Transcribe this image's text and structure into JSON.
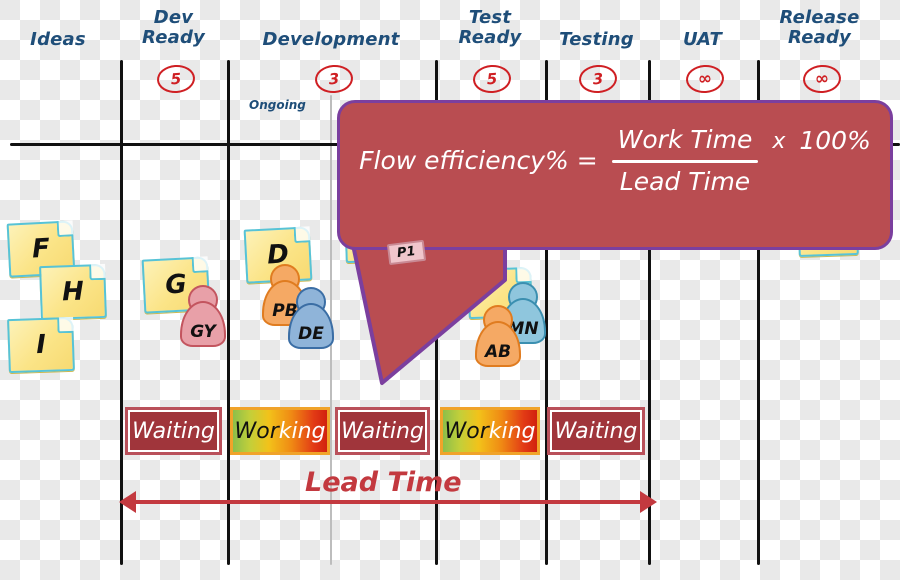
{
  "board": {
    "columns": [
      {
        "id": "ideas",
        "label_lines": [
          "Ideas"
        ],
        "wip": null
      },
      {
        "id": "dev-ready",
        "label_lines": [
          "Dev",
          "Ready"
        ],
        "wip": "5"
      },
      {
        "id": "development",
        "label_lines": [
          "Development"
        ],
        "wip": "3",
        "sublabel": "Ongoing"
      },
      {
        "id": "test-ready",
        "label_lines": [
          "Test",
          "Ready"
        ],
        "wip": "5"
      },
      {
        "id": "testing",
        "label_lines": [
          "Testing"
        ],
        "wip": "3"
      },
      {
        "id": "uat",
        "label_lines": [
          "UAT"
        ],
        "wip": "∞"
      },
      {
        "id": "release-ready",
        "label_lines": [
          "Release",
          "Ready"
        ],
        "wip": "∞"
      }
    ]
  },
  "cards": [
    {
      "id": "card-f",
      "label": "F"
    },
    {
      "id": "card-h",
      "label": "H"
    },
    {
      "id": "card-i",
      "label": "I"
    },
    {
      "id": "card-g",
      "label": "G"
    },
    {
      "id": "card-d",
      "label": "D"
    },
    {
      "id": "card-p1-note",
      "label": ""
    },
    {
      "id": "card-testing-note",
      "label": ""
    },
    {
      "id": "card-release-note",
      "label": ""
    }
  ],
  "avatars": [
    {
      "id": "avatar-gy",
      "label": "GY",
      "fill": "#e8a0a8",
      "stroke": "#c3555f"
    },
    {
      "id": "avatar-pb",
      "label": "PB",
      "fill": "#f5a964",
      "stroke": "#e07c20"
    },
    {
      "id": "avatar-de",
      "label": "DE",
      "fill": "#8fb4d9",
      "stroke": "#3b6ea5"
    },
    {
      "id": "avatar-ab",
      "label": "AB",
      "fill": "#f5a964",
      "stroke": "#e07c20"
    },
    {
      "id": "avatar-mn",
      "label": "MN",
      "fill": "#8fc6dd",
      "stroke": "#3b8fb0"
    }
  ],
  "tags": [
    {
      "id": "tag-p1",
      "label": "P1",
      "color": "#f0c6cc"
    }
  ],
  "status_bars": [
    {
      "id": "status-dev-ready",
      "label": "Waiting",
      "state": "waiting"
    },
    {
      "id": "status-development",
      "label": "Working",
      "state": "working",
      "label_part_1": "Wor",
      "label_part_2": "king"
    },
    {
      "id": "status-test-ready",
      "label": "Waiting",
      "state": "waiting"
    },
    {
      "id": "status-testing",
      "label": "Working",
      "state": "working",
      "label_part_1": "Wor",
      "label_part_2": "king"
    },
    {
      "id": "status-uat",
      "label": "Waiting",
      "state": "waiting"
    }
  ],
  "lead_time": {
    "label": "Lead Time"
  },
  "callout": {
    "title": "Flow efficiency% =",
    "numerator": "Work Time",
    "denominator": "Lead Time",
    "multiply": "x",
    "percent": "100%",
    "bubble_color": "#b94d51",
    "border_color": "#7b3f9e"
  },
  "colors": {
    "header_text": "#1f4e79",
    "wip_limit": "#cf1f23",
    "waiting": "#a0353b",
    "lead_time_arrow": "#c3393f",
    "sticky": "#fbe487",
    "sticky_border": "#57c3d6"
  }
}
